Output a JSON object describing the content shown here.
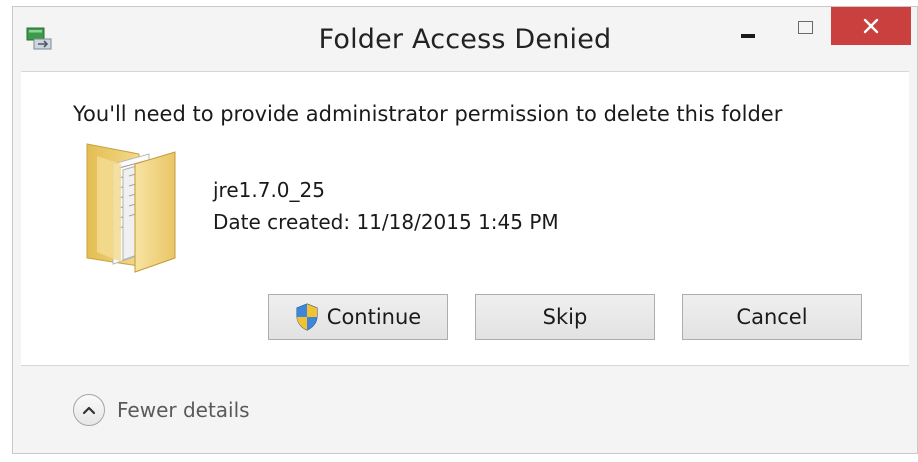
{
  "window": {
    "title": "Folder Access Denied",
    "icon": "file-transfer-icon"
  },
  "titlebar_controls": {
    "minimize": "minimize-icon",
    "maximize": "maximize-icon",
    "close_label": "✕"
  },
  "dialog": {
    "message": "You'll need to provide administrator permission to delete this folder",
    "item": {
      "name": "jre1.7.0_25",
      "date_created": "Date created: 11/18/2015 1:45 PM",
      "icon": "folder-icon"
    },
    "buttons": {
      "continue_label": "Continue",
      "continue_icon": "uac-shield-icon",
      "skip_label": "Skip",
      "cancel_label": "Cancel"
    }
  },
  "footer": {
    "details_label": "Fewer details",
    "details_icon": "chevron-up-icon"
  },
  "colors": {
    "close_button": "#c9403f",
    "window_chrome": "#f4f4f4",
    "content_background": "#ffffff"
  }
}
